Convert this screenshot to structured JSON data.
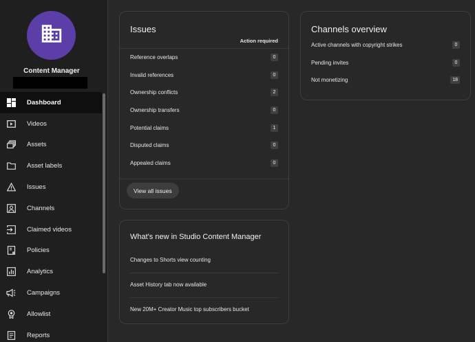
{
  "sidebar": {
    "channel_name": "Content Manager",
    "items": [
      {
        "label": "Dashboard",
        "icon": "dashboard-icon",
        "active": true
      },
      {
        "label": "Videos",
        "icon": "video-icon"
      },
      {
        "label": "Assets",
        "icon": "assets-icon"
      },
      {
        "label": "Asset labels",
        "icon": "folder-icon"
      },
      {
        "label": "Issues",
        "icon": "warning-icon"
      },
      {
        "label": "Channels",
        "icon": "channel-icon"
      },
      {
        "label": "Claimed videos",
        "icon": "claimed-icon"
      },
      {
        "label": "Policies",
        "icon": "policy-icon"
      },
      {
        "label": "Analytics",
        "icon": "analytics-icon"
      },
      {
        "label": "Campaigns",
        "icon": "megaphone-icon"
      },
      {
        "label": "Allowlist",
        "icon": "award-icon"
      },
      {
        "label": "Reports",
        "icon": "report-icon"
      }
    ]
  },
  "issues": {
    "title": "Issues",
    "column_header": "Action required",
    "rows": [
      {
        "label": "Reference overlaps",
        "count": "0"
      },
      {
        "label": "Invalid references",
        "count": "0"
      },
      {
        "label": "Ownership conflicts",
        "count": "2"
      },
      {
        "label": "Ownership transfers",
        "count": "0"
      },
      {
        "label": "Potential claims",
        "count": "1"
      },
      {
        "label": "Disputed claims",
        "count": "0"
      },
      {
        "label": "Appealed claims",
        "count": "0"
      }
    ],
    "button": "View all issues"
  },
  "overview": {
    "title": "Channels overview",
    "rows": [
      {
        "label": "Active channels with copyright strikes",
        "count": "0"
      },
      {
        "label": "Pending invites",
        "count": "0"
      },
      {
        "label": "Not monetizing",
        "count": "18"
      }
    ]
  },
  "whatsnew": {
    "title": "What's new in Studio Content Manager",
    "items": [
      "Changes to Shorts view counting",
      "Asset History tab now available",
      "New 20M+ Creator Music top subscribers bucket"
    ]
  }
}
